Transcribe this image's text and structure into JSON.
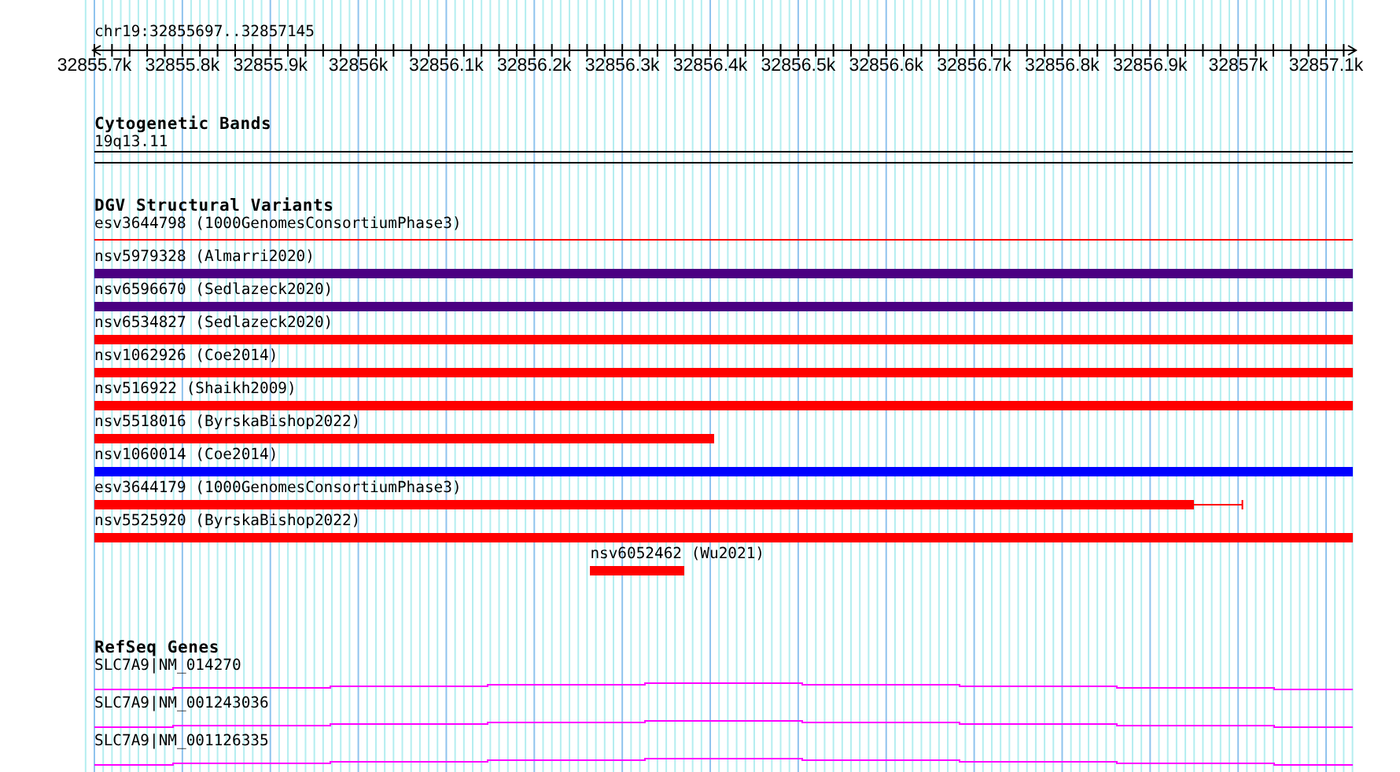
{
  "location": "chr19:32855697..32857145",
  "ruler": {
    "labels": [
      "32855.7k",
      "32855.8k",
      "32855.9k",
      "32856k",
      "32856.1k",
      "32856.2k",
      "32856.3k",
      "32856.4k",
      "32856.5k",
      "32856.6k",
      "32856.7k",
      "32856.8k",
      "32856.9k",
      "32857k",
      "32857.1k"
    ]
  },
  "tracks": [
    {
      "kind": "bands",
      "title": "Cytogenetic Bands",
      "features": [
        {
          "label": "19q13.11"
        }
      ]
    },
    {
      "kind": "variants",
      "title": "DGV Structural Variants",
      "features": [
        {
          "label": "esv3644798 (1000GenomesConsortiumPhase3)",
          "kind": "thin",
          "color": "#ff0000"
        },
        {
          "label": "nsv5979328 (Almarri2020)",
          "kind": "bar",
          "color": "#4b0082"
        },
        {
          "label": "nsv6596670 (Sedlazeck2020)",
          "kind": "bar",
          "color": "#4b0082"
        },
        {
          "label": "nsv6534827 (Sedlazeck2020)",
          "kind": "bar",
          "color": "#ff0000"
        },
        {
          "label": "nsv1062926 (Coe2014)",
          "kind": "bar",
          "color": "#ff0000"
        },
        {
          "label": "nsv516922 (Shaikh2009)",
          "kind": "bar",
          "color": "#ff0000"
        },
        {
          "label": "nsv5518016 (ByrskaBishop2022)",
          "kind": "bar",
          "color": "#ff0000"
        },
        {
          "label": "nsv1060014 (Coe2014)",
          "kind": "bar",
          "color": "#0000ff"
        },
        {
          "label": "esv3644179 (1000GenomesConsortiumPhase3)",
          "kind": "bar",
          "color": "#ff0000"
        },
        {
          "label": "nsv5525920 (ByrskaBishop2022)",
          "kind": "bar",
          "color": "#ff0000"
        },
        {
          "label": "nsv6052462 (Wu2021)",
          "kind": "bar",
          "color": "#ff0000"
        }
      ]
    },
    {
      "kind": "genes",
      "title": "RefSeq Genes",
      "features": [
        {
          "label": "SLC7A9|NM_014270"
        },
        {
          "label": "SLC7A9|NM_001243036"
        },
        {
          "label": "SLC7A9|NM_001126335"
        }
      ]
    }
  ]
}
